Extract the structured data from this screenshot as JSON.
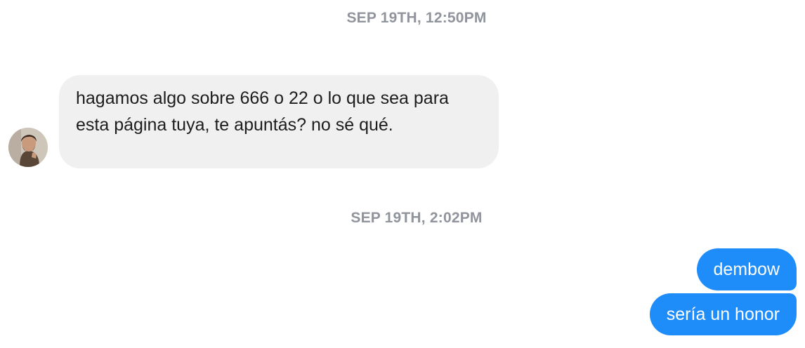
{
  "conversation": {
    "timestamps": [
      "SEP 19TH, 12:50PM",
      "SEP 19TH, 2:02PM"
    ],
    "incoming": {
      "text": "hagamos algo sobre 666 o 22 o lo que sea para esta página tuya, te apuntás? no sé qué."
    },
    "outgoing": [
      {
        "text": "dembow"
      },
      {
        "text": "sería un honor"
      }
    ]
  },
  "colors": {
    "outgoing_bubble": "#1e8cf9",
    "incoming_bubble": "#f1f0f0",
    "timestamp_text": "#90949c"
  },
  "icons": {
    "sender_avatar": "user-avatar-photo"
  }
}
